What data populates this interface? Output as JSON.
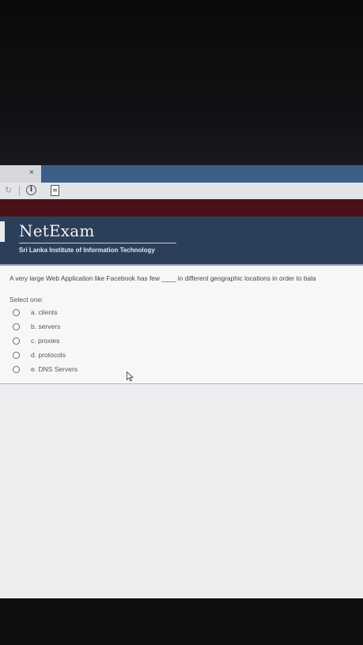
{
  "browser": {
    "tab_close": "×",
    "reload_icon": "reload-icon",
    "info_symbol": "i"
  },
  "header": {
    "logo": "NetExam",
    "subtitle": "Sri Lanka Institute of Information Technology",
    "colors": {
      "maroon_bar": "#4a1119",
      "header_bg": "#2c3f5a",
      "tab_bar": "#3c5f86"
    }
  },
  "quiz": {
    "question": "A very large Web Application like Facebook  has few ____ in different geographic locations in order to bala",
    "select_label": "Select one:",
    "options": [
      {
        "label": "a. clients",
        "selected": false
      },
      {
        "label": "b. servers",
        "selected": false
      },
      {
        "label": "c. proxies",
        "selected": false
      },
      {
        "label": "d. protocols",
        "selected": false
      },
      {
        "label": "e. DNS Servers",
        "selected": false
      }
    ]
  }
}
